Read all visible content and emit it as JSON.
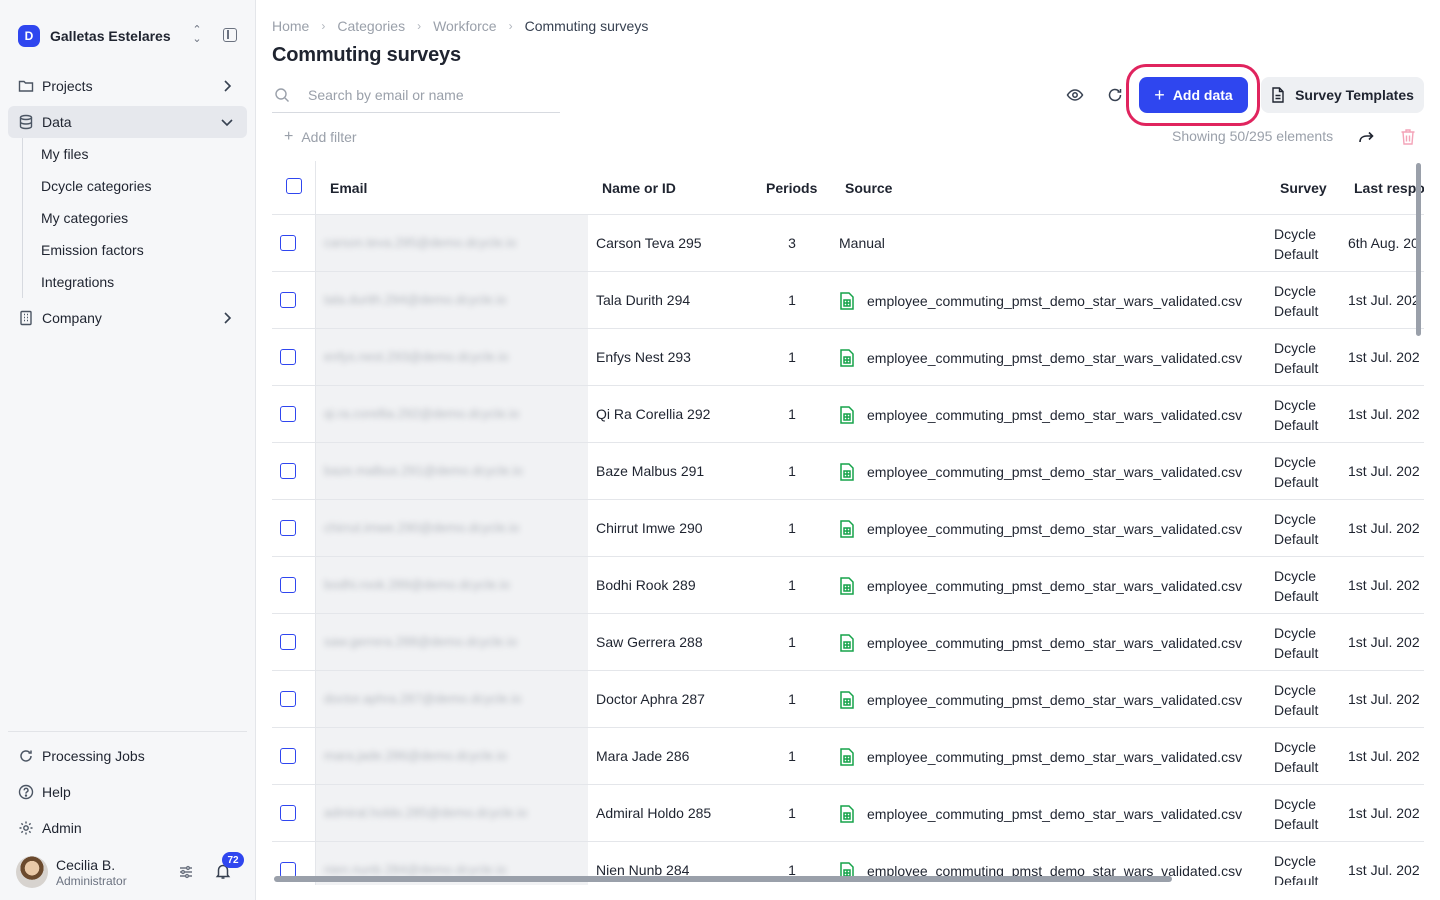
{
  "org": {
    "name": "Galletas Estelares",
    "logo_letter": "D"
  },
  "sidebar": {
    "items": [
      {
        "label": "Projects",
        "icon": "folder-icon"
      },
      {
        "label": "Data",
        "icon": "database-icon",
        "active": true
      },
      {
        "label": "Company",
        "icon": "building-icon"
      }
    ],
    "data_children": [
      "My files",
      "Dcycle categories",
      "My categories",
      "Emission factors",
      "Integrations"
    ],
    "bottom": [
      {
        "label": "Processing Jobs",
        "icon": "refresh-icon"
      },
      {
        "label": "Help",
        "icon": "help-icon"
      },
      {
        "label": "Admin",
        "icon": "gear-icon"
      }
    ]
  },
  "user": {
    "name": "Cecilia B.",
    "role": "Administrator",
    "notifications": "72"
  },
  "breadcrumb": [
    "Home",
    "Categories",
    "Workforce",
    "Commuting surveys"
  ],
  "page": {
    "title": "Commuting surveys"
  },
  "search": {
    "placeholder": "Search by email or name",
    "value": ""
  },
  "toolbar": {
    "add_label": "Add data",
    "templates_label": "Survey Templates",
    "add_filter_label": "Add filter",
    "showing": "Showing 50/295 elements"
  },
  "colors": {
    "accent": "#2f46ef",
    "highlight": "#e0245e",
    "file_icon": "#16a34a",
    "delete": "#f4a3b8"
  },
  "table": {
    "columns": [
      "Email",
      "Name or ID",
      "Periods",
      "Source",
      "Survey",
      "Last respo"
    ],
    "rows": [
      {
        "email": "carson.teva.295@demo.dcycle.io",
        "name": "Carson Teva 295",
        "periods": "3",
        "source": "Manual",
        "source_is_file": false,
        "survey": [
          "Dcycle",
          "Default"
        ],
        "last": "6th Aug. 20"
      },
      {
        "email": "tala.durith.294@demo.dcycle.io",
        "name": "Tala Durith 294",
        "periods": "1",
        "source": "employee_commuting_pmst_demo_star_wars_validated.csv",
        "source_is_file": true,
        "survey": [
          "Dcycle",
          "Default"
        ],
        "last": "1st Jul. 202"
      },
      {
        "email": "enfys.nest.293@demo.dcycle.io",
        "name": "Enfys Nest 293",
        "periods": "1",
        "source": "employee_commuting_pmst_demo_star_wars_validated.csv",
        "source_is_file": true,
        "survey": [
          "Dcycle",
          "Default"
        ],
        "last": "1st Jul. 202"
      },
      {
        "email": "qi.ra.corellia.292@demo.dcycle.io",
        "name": "Qi Ra Corellia 292",
        "periods": "1",
        "source": "employee_commuting_pmst_demo_star_wars_validated.csv",
        "source_is_file": true,
        "survey": [
          "Dcycle",
          "Default"
        ],
        "last": "1st Jul. 202"
      },
      {
        "email": "baze.malbus.291@demo.dcycle.io",
        "name": "Baze Malbus 291",
        "periods": "1",
        "source": "employee_commuting_pmst_demo_star_wars_validated.csv",
        "source_is_file": true,
        "survey": [
          "Dcycle",
          "Default"
        ],
        "last": "1st Jul. 202"
      },
      {
        "email": "chirrut.imwe.290@demo.dcycle.io",
        "name": "Chirrut Imwe 290",
        "periods": "1",
        "source": "employee_commuting_pmst_demo_star_wars_validated.csv",
        "source_is_file": true,
        "survey": [
          "Dcycle",
          "Default"
        ],
        "last": "1st Jul. 202"
      },
      {
        "email": "bodhi.rook.289@demo.dcycle.io",
        "name": "Bodhi Rook 289",
        "periods": "1",
        "source": "employee_commuting_pmst_demo_star_wars_validated.csv",
        "source_is_file": true,
        "survey": [
          "Dcycle",
          "Default"
        ],
        "last": "1st Jul. 202"
      },
      {
        "email": "saw.gerrera.288@demo.dcycle.io",
        "name": "Saw Gerrera 288",
        "periods": "1",
        "source": "employee_commuting_pmst_demo_star_wars_validated.csv",
        "source_is_file": true,
        "survey": [
          "Dcycle",
          "Default"
        ],
        "last": "1st Jul. 202"
      },
      {
        "email": "doctor.aphra.287@demo.dcycle.io",
        "name": "Doctor Aphra 287",
        "periods": "1",
        "source": "employee_commuting_pmst_demo_star_wars_validated.csv",
        "source_is_file": true,
        "survey": [
          "Dcycle",
          "Default"
        ],
        "last": "1st Jul. 202"
      },
      {
        "email": "mara.jade.286@demo.dcycle.io",
        "name": "Mara Jade 286",
        "periods": "1",
        "source": "employee_commuting_pmst_demo_star_wars_validated.csv",
        "source_is_file": true,
        "survey": [
          "Dcycle",
          "Default"
        ],
        "last": "1st Jul. 202"
      },
      {
        "email": "admiral.holdo.285@demo.dcycle.io",
        "name": "Admiral Holdo 285",
        "periods": "1",
        "source": "employee_commuting_pmst_demo_star_wars_validated.csv",
        "source_is_file": true,
        "survey": [
          "Dcycle",
          "Default"
        ],
        "last": "1st Jul. 202"
      },
      {
        "email": "nien.nunb.284@demo.dcycle.io",
        "name": "Nien Nunb 284",
        "periods": "1",
        "source": "employee_commuting_pmst_demo_star_wars_validated.csv",
        "source_is_file": true,
        "survey": [
          "Dcycle",
          "Default"
        ],
        "last": "1st Jul. 202"
      }
    ]
  }
}
